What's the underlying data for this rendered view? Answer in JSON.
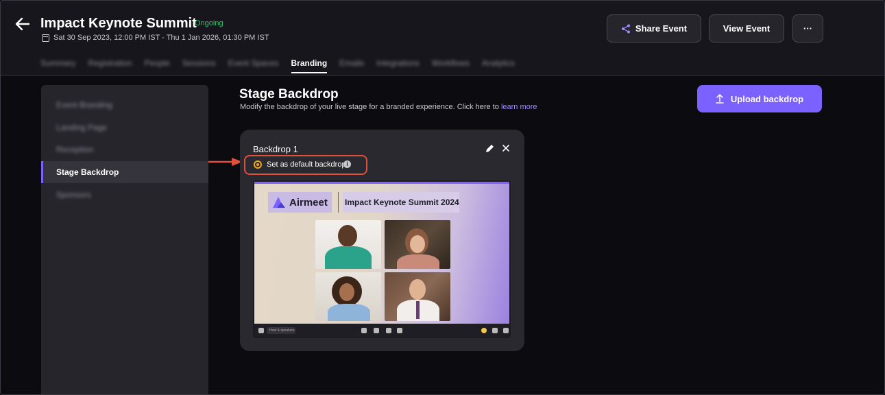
{
  "header": {
    "title": "Impact Keynote Summit",
    "status": "Ongoing",
    "dates": "Sat 30 Sep 2023, 12:00 PM IST - Thu 1 Jan 2026, 01:30 PM IST",
    "buttons": {
      "share": "Share Event",
      "view": "View Event",
      "more": "···"
    }
  },
  "tabs": [
    {
      "label": "Summary"
    },
    {
      "label": "Registration"
    },
    {
      "label": "People"
    },
    {
      "label": "Sessions"
    },
    {
      "label": "Event Spaces"
    },
    {
      "label": "Branding"
    },
    {
      "label": "Emails"
    },
    {
      "label": "Integrations"
    },
    {
      "label": "Workflows"
    },
    {
      "label": "Analytics"
    }
  ],
  "sidebar": {
    "items": [
      {
        "label": "Event Branding"
      },
      {
        "label": "Landing Page"
      },
      {
        "label": "Reception"
      },
      {
        "label": "Stage Backdrop"
      },
      {
        "label": "Sponsors"
      }
    ]
  },
  "main": {
    "title": "Stage Backdrop",
    "subtitle": "Modify the backdrop of your live stage for a branded experience. Click here to",
    "subtitle_link": "learn more",
    "upload_label": "Upload backdrop"
  },
  "backdrop_card": {
    "name": "Backdrop 1",
    "default_label": "Set as default backdrop",
    "default_selected": true,
    "preview": {
      "brand": "Airmeet",
      "event_title": "Impact Keynote Summit 2024",
      "toolbar_label": "Host & speakers"
    }
  },
  "colors": {
    "accent": "#7b61ff",
    "status_green": "#2fc46b",
    "highlight": "#e0503a",
    "radio": "#f5a623"
  }
}
